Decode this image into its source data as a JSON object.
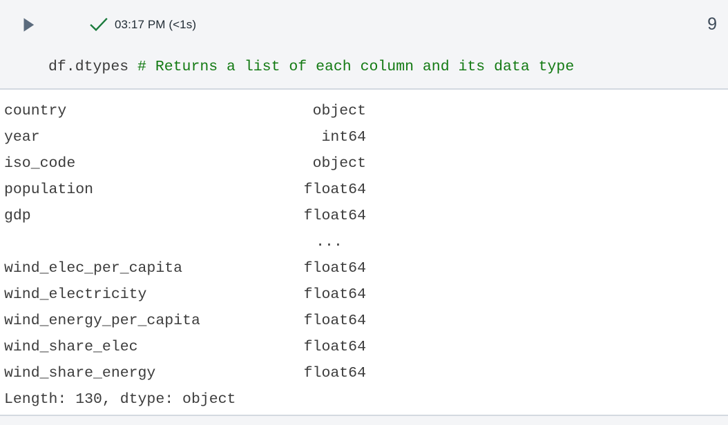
{
  "cell": {
    "number": "9",
    "run_button_icon": "play-triangle-icon",
    "status_icon": "check-success-icon",
    "status_text": "03:17 PM (<1s)",
    "source": {
      "code": "df.dtypes ",
      "comment": "# Returns a list of each column and its data type"
    }
  },
  "colors": {
    "header_background": "#f4f5f7",
    "divider": "#d3d9e0",
    "play_icon": "#5b6b7d",
    "success_check": "#1a7a3c",
    "comment_green": "#137a13",
    "code_text": "#3b3b3b",
    "output_text": "#3c3c3c",
    "cell_number": "#3f4c5a"
  },
  "output": {
    "rows": [
      {
        "name": "country",
        "dtype": "object"
      },
      {
        "name": "year",
        "dtype": "int64"
      },
      {
        "name": "iso_code",
        "dtype": "object"
      },
      {
        "name": "population",
        "dtype": "float64"
      },
      {
        "name": "gdp",
        "dtype": "float64"
      },
      {
        "name": "",
        "dtype": "..."
      },
      {
        "name": "wind_elec_per_capita",
        "dtype": "float64"
      },
      {
        "name": "wind_electricity",
        "dtype": "float64"
      },
      {
        "name": "wind_energy_per_capita",
        "dtype": "float64"
      },
      {
        "name": "wind_share_elec",
        "dtype": "float64"
      },
      {
        "name": "wind_share_energy",
        "dtype": "float64"
      }
    ],
    "summary": "Length: 130, dtype: object"
  }
}
